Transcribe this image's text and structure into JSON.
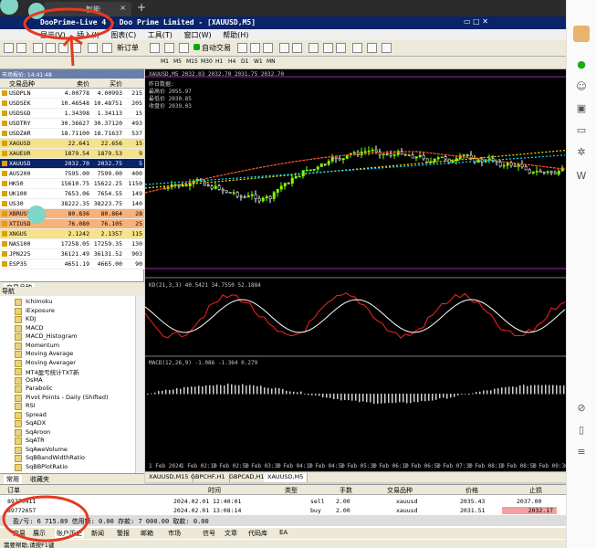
{
  "browser": {
    "tab_title": "智能",
    "close": "×",
    "new_tab": "+"
  },
  "window": {
    "title": "DooPrime-Live 4 - Doo Prime Limited - [XAUUSD,M5]",
    "controls": "▭ □ ✕",
    "menu": [
      "显示(V)",
      "插入(I)",
      "图表(C)",
      "工具(T)",
      "窗口(W)",
      "帮助(H)"
    ]
  },
  "toolbar": {
    "new_chart": "新订单",
    "auto_trade": "自动交易",
    "timeframes": [
      "M1",
      "M5",
      "M15",
      "M30",
      "H1",
      "H4",
      "D1",
      "W1",
      "MN"
    ]
  },
  "market_watch": {
    "title": "市场报价: 14:41:48",
    "headers": {
      "symbol": "交易品种",
      "bid": "卖价",
      "ask": "买价"
    },
    "rows": [
      {
        "symbol": "USDPLN",
        "bid": "4.00778",
        "ask": "4.00993",
        "spread": "215",
        "bg": "#ffffff"
      },
      {
        "symbol": "USDSEK",
        "bid": "10.46548",
        "ask": "10.48751",
        "spread": "205",
        "bg": "#ffffff"
      },
      {
        "symbol": "USDSGD",
        "bid": "1.34398",
        "ask": "1.34113",
        "spread": "15",
        "bg": "#ffffff"
      },
      {
        "symbol": "USDTRY",
        "bid": "30.36627",
        "ask": "30.37120",
        "spread": "493",
        "bg": "#ffffff"
      },
      {
        "symbol": "USDZAR",
        "bid": "18.71100",
        "ask": "18.71637",
        "spread": "537",
        "bg": "#ffffff"
      },
      {
        "symbol": "XAGUSD",
        "bid": "22.641",
        "ask": "22.656",
        "spread": "15",
        "bg": "#f5e28a"
      },
      {
        "symbol": "XAUEUR",
        "bid": "1879.54",
        "ask": "1879.53",
        "spread": "9",
        "bg": "#f5e28a"
      },
      {
        "symbol": "XAUUSD",
        "bid": "2032.70",
        "ask": "2032.75",
        "spread": "5",
        "bg": "#0a246a",
        "color": "#ffffff"
      },
      {
        "symbol": "AUS200",
        "bid": "7595.00",
        "ask": "7599.00",
        "spread": "400",
        "bg": "#ffffff"
      },
      {
        "symbol": "HK50",
        "bid": "15610.75",
        "ask": "15622.25",
        "spread": "1150",
        "bg": "#ffffff"
      },
      {
        "symbol": "UK100",
        "bid": "7653.06",
        "ask": "7654.55",
        "spread": "149",
        "bg": "#ffffff"
      },
      {
        "symbol": "US30",
        "bid": "38222.35",
        "ask": "38223.75",
        "spread": "140",
        "bg": "#ffffff"
      },
      {
        "symbol": "XBRUSD",
        "bid": "80.836",
        "ask": "80.864",
        "spread": "28",
        "bg": "#f7b27a"
      },
      {
        "symbol": "XTIUSD",
        "bid": "76.080",
        "ask": "76.105",
        "spread": "25",
        "bg": "#f7b27a"
      },
      {
        "symbol": "XNGUS",
        "bid": "2.1242",
        "ask": "2.1357",
        "spread": "115",
        "bg": "#f5e28a"
      },
      {
        "symbol": "NAS100",
        "bid": "17258.05",
        "ask": "17259.35",
        "spread": "130",
        "bg": "#ffffff"
      },
      {
        "symbol": "JPN225",
        "bid": "36121.49",
        "ask": "36131.52",
        "spread": "903",
        "bg": "#ffffff"
      },
      {
        "symbol": "ESP35",
        "bid": "4651.19",
        "ask": "4665.00",
        "spread": "90",
        "bg": "#ffffff"
      }
    ],
    "tabs": [
      "交易品种"
    ]
  },
  "navigator": {
    "title": "导航",
    "items": [
      "Ichimoku",
      "iExposure",
      "KDJ",
      "MACD",
      "MACD_Histogram",
      "Momentum",
      "Moving Average",
      "Moving Averager",
      "MT4盈亏统计TXT新",
      "OsMA",
      "Parabolic",
      "Pivot Points - Daily (Shifted)",
      "RSI",
      "Spread",
      "SqADX",
      "SqAroon",
      "SqATR",
      "SqAweVolume",
      "SqBBandWidthRatio",
      "SqBBPlotRatio"
    ],
    "tabs": [
      "常用",
      "收藏夹"
    ]
  },
  "chart": {
    "symbol_label": "XAUUSD,M5 2032.03 2032.70 2031.75 2032.70",
    "info_lines": [
      "昨日数据:",
      "最高价 2055.97",
      "最低价 2030.85",
      "收盘价 2039.03"
    ],
    "kd_label": "KD(21,3,3) 40.5421 34.7550 52.1884",
    "macd_label": "MACD(12,26,9) -1.086 -1.364 0.279",
    "time_labels": [
      "1 Feb 2024",
      "1 Feb 02:10",
      "1 Feb 02:50",
      "1 Feb 03:30",
      "1 Feb 04:10",
      "1 Feb 04:50",
      "1 Feb 05:30",
      "1 Feb 06:10",
      "1 Feb 06:50",
      "1 Feb 07:30",
      "1 Feb 08:10",
      "1 Feb 08:50",
      "1 Feb 09:30"
    ],
    "tabs": [
      "XAUUSD,M15",
      "GBPCHF,H1",
      "GBPCAD,H1",
      "XAUUSD,M5"
    ],
    "active_tab": 3
  },
  "terminal": {
    "headers": {
      "order": "订单",
      "time": "时间",
      "type": "类型",
      "lots": "手数",
      "symbol": "交易品种",
      "price": "价格",
      "sl": "止损"
    },
    "rows": [
      {
        "order": "89770411",
        "time": "2024.02.01 12:40:01",
        "type": "sell",
        "lots": "2.00",
        "symbol": "xauusd",
        "price": "2035.43",
        "sl": "2037.00"
      },
      {
        "order": "89772657",
        "time": "2024.02.01 13:08:14",
        "type": "buy",
        "lots": "2.00",
        "symbol": "xauusd",
        "price": "2031.51",
        "sl": "2032.17"
      }
    ],
    "balance": "盈/亏: 6 715.89  信用额: 0.00  存款: 7 000.00  取款: 0.00",
    "tabs": [
      "交易",
      "展示",
      "账户历史",
      "新闻",
      "警报",
      "邮箱",
      "市场",
      "信号",
      "文章",
      "代码库",
      "EA"
    ],
    "status": "需要帮助,请按F1键"
  }
}
